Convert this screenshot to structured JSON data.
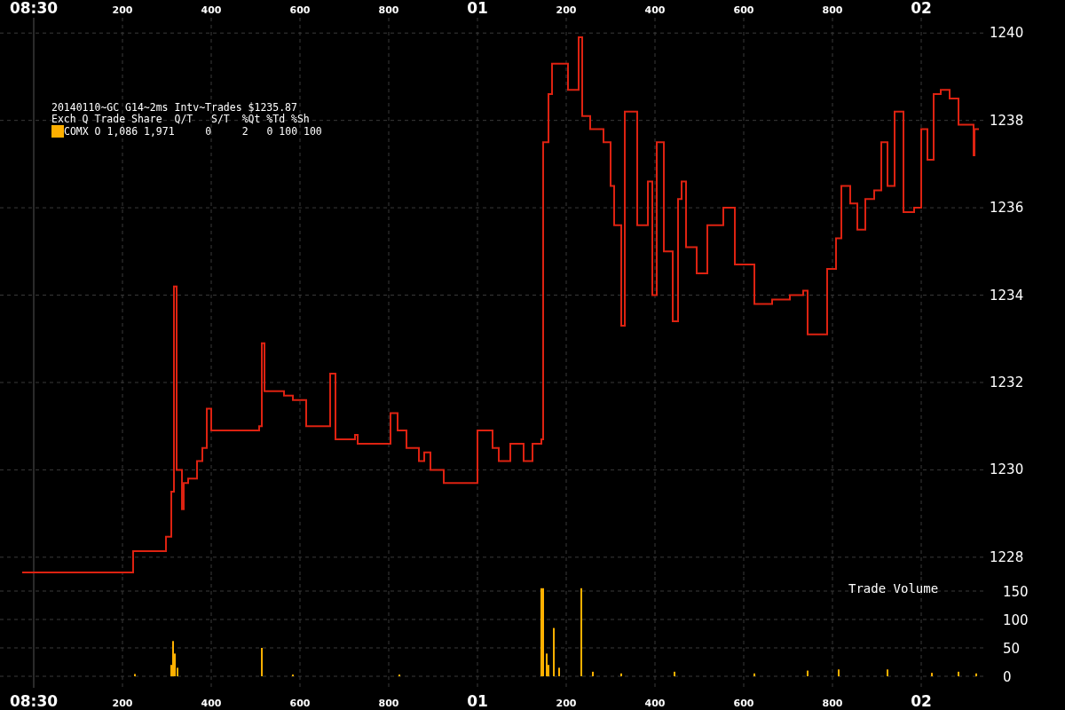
{
  "top_axis": {
    "labels": [
      "08:30",
      "01",
      "200",
      "400",
      "600",
      "800",
      "02"
    ]
  },
  "legend": {
    "title": "20140110~GC G14~2ms Intv~Trades $1235.87",
    "header": "Exch Q Trade Share  Q/T   S/T  %Qt %Td %Sh",
    "rows": [
      {
        "text": "COMX O 1,086 1,971     0     2   0 100 100",
        "color": "#ffb000"
      }
    ]
  },
  "price": {
    "chart_data": {
      "type": "line",
      "grid": true,
      "xlim": [
        -76,
        2140
      ],
      "ylim": [
        1227.55,
        1240.35
      ],
      "xticks": [
        200,
        400,
        600,
        800
      ],
      "yticks": [
        {
          "value": 1228,
          "label": "1228"
        },
        {
          "value": 1230,
          "label": "1230"
        },
        {
          "value": 1232,
          "label": "1232"
        },
        {
          "value": 1234,
          "label": "1234"
        },
        {
          "value": 1236,
          "label": "1236"
        },
        {
          "value": 1238,
          "label": "1238"
        },
        {
          "value": 1240,
          "label": "1240"
        }
      ],
      "x": [
        -26,
        224,
        224,
        298,
        298,
        310,
        310,
        316,
        316,
        322,
        322,
        334,
        334,
        338,
        338,
        348,
        348,
        368,
        368,
        380,
        380,
        390,
        390,
        400,
        400,
        508,
        508,
        514,
        514,
        520,
        520,
        564,
        564,
        584,
        584,
        614,
        614,
        668,
        668,
        680,
        680,
        724,
        724,
        730,
        730,
        804,
        804,
        820,
        820,
        840,
        840,
        868,
        868,
        880,
        880,
        894,
        894,
        924,
        924,
        1000,
        1000,
        1034,
        1034,
        1048,
        1048,
        1074,
        1074,
        1104,
        1104,
        1124,
        1124,
        1144,
        1144,
        1148,
        1148,
        1160,
        1160,
        1168,
        1168,
        1204,
        1204,
        1228,
        1228,
        1236,
        1236,
        1254,
        1254,
        1284,
        1284,
        1300,
        1300,
        1308,
        1308,
        1324,
        1324,
        1332,
        1332,
        1360,
        1360,
        1384,
        1384,
        1394,
        1394,
        1404,
        1404,
        1420,
        1420,
        1440,
        1440,
        1452,
        1452,
        1460,
        1460,
        1470,
        1470,
        1494,
        1494,
        1518,
        1518,
        1554,
        1554,
        1580,
        1580,
        1624,
        1624,
        1664,
        1664,
        1704,
        1704,
        1734,
        1734,
        1744,
        1744,
        1788,
        1788,
        1808,
        1808,
        1820,
        1820,
        1840,
        1840,
        1856,
        1856,
        1874,
        1874,
        1894,
        1894,
        1910,
        1910,
        1924,
        1924,
        1940,
        1940,
        1960,
        1960,
        1984,
        1984,
        2000,
        2000,
        2014,
        2014,
        2028,
        2028,
        2044,
        2044,
        2064,
        2064,
        2084,
        2084,
        2118,
        2118,
        2120,
        2120,
        2130
      ],
      "series": [
        {
          "color": "#dd2211",
          "values": [
            1227.65,
            1227.65,
            1228.14,
            1228.14,
            1228.47,
            1228.47,
            1229.5,
            1229.5,
            1234.2,
            1234.2,
            1230.0,
            1230.0,
            1229.1,
            1229.1,
            1229.7,
            1229.7,
            1229.8,
            1229.8,
            1230.2,
            1230.2,
            1230.5,
            1230.5,
            1231.4,
            1231.4,
            1230.9,
            1230.9,
            1231.0,
            1231.0,
            1232.9,
            1232.9,
            1231.8,
            1231.8,
            1231.7,
            1231.7,
            1231.6,
            1231.6,
            1231.0,
            1231.0,
            1232.2,
            1232.2,
            1230.7,
            1230.7,
            1230.8,
            1230.8,
            1230.6,
            1230.6,
            1231.3,
            1231.3,
            1230.9,
            1230.9,
            1230.5,
            1230.5,
            1230.2,
            1230.2,
            1230.4,
            1230.4,
            1230.0,
            1230.0,
            1229.7,
            1229.7,
            1230.9,
            1230.9,
            1230.5,
            1230.5,
            1230.2,
            1230.2,
            1230.6,
            1230.6,
            1230.2,
            1230.2,
            1230.6,
            1230.6,
            1230.7,
            1230.7,
            1237.5,
            1237.5,
            1238.6,
            1238.6,
            1239.3,
            1239.3,
            1238.7,
            1238.7,
            1239.9,
            1239.9,
            1238.1,
            1238.1,
            1237.8,
            1237.8,
            1237.5,
            1237.5,
            1236.5,
            1236.5,
            1235.6,
            1235.6,
            1233.3,
            1233.3,
            1238.2,
            1238.2,
            1235.6,
            1235.6,
            1236.6,
            1236.6,
            1234.0,
            1234.0,
            1237.5,
            1237.5,
            1235.0,
            1235.0,
            1233.4,
            1233.4,
            1236.2,
            1236.2,
            1236.6,
            1236.6,
            1235.1,
            1235.1,
            1234.5,
            1234.5,
            1235.6,
            1235.6,
            1236.0,
            1236.0,
            1234.7,
            1234.7,
            1233.8,
            1233.8,
            1233.9,
            1233.9,
            1234.0,
            1234.0,
            1234.1,
            1234.1,
            1233.1,
            1233.1,
            1234.6,
            1234.6,
            1235.3,
            1235.3,
            1236.5,
            1236.5,
            1236.1,
            1236.1,
            1235.5,
            1235.5,
            1236.2,
            1236.2,
            1236.4,
            1236.4,
            1237.5,
            1237.5,
            1236.5,
            1236.5,
            1238.2,
            1238.2,
            1235.9,
            1235.9,
            1236.0,
            1236.0,
            1237.8,
            1237.8,
            1237.1,
            1237.1,
            1238.6,
            1238.6,
            1238.7,
            1238.7,
            1238.5,
            1238.5,
            1237.9,
            1237.9,
            1237.2,
            1237.2,
            1237.8,
            1237.8
          ]
        }
      ]
    }
  },
  "volume": {
    "chart_data": {
      "type": "bar",
      "title": "Trade Volume",
      "grid": true,
      "xlim": [
        -76,
        2140
      ],
      "ylim": [
        -20.3,
        175
      ],
      "xticks": [
        200,
        400,
        600,
        800
      ],
      "yticks": [
        {
          "value": 0,
          "label": "0"
        },
        {
          "value": 50,
          "label": "50"
        },
        {
          "value": 100,
          "label": "100"
        },
        {
          "value": 150,
          "label": "150"
        }
      ],
      "x": [
        228,
        310,
        314,
        318,
        324,
        514,
        584,
        824,
        1144,
        1148,
        1156,
        1160,
        1172,
        1184,
        1234,
        1260,
        1324,
        1444,
        1624,
        1744,
        1814,
        1924,
        2024,
        2084,
        2124
      ],
      "series": [
        {
          "color": "#ffb000",
          "values": [
            4,
            20,
            62,
            40,
            15,
            50,
            3,
            3,
            155,
            155,
            40,
            20,
            85,
            15,
            155,
            8,
            5,
            8,
            5,
            10,
            12,
            12,
            6,
            8,
            5
          ]
        }
      ]
    }
  },
  "bottom_axis": {
    "labels": [
      "08:30",
      "01",
      "200",
      "400",
      "600",
      "800",
      "02"
    ]
  }
}
